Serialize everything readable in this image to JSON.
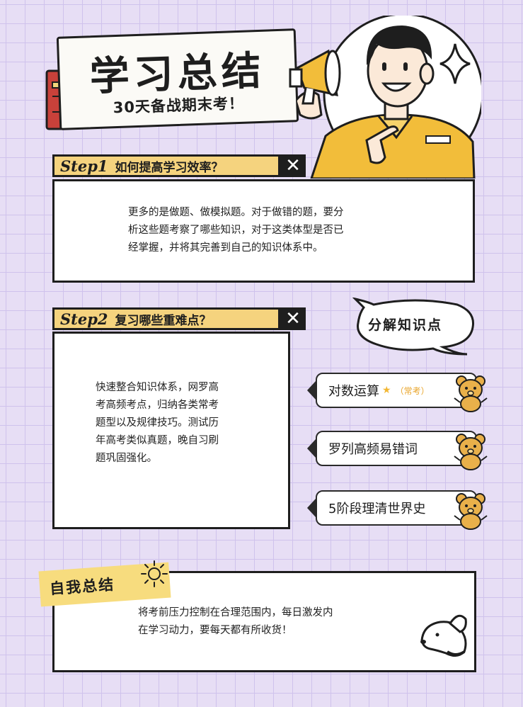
{
  "header": {
    "title": "学习总结",
    "subtitle": "30天备战期末考！"
  },
  "step1": {
    "tag": "Step1",
    "question": "如何提高学习效率？",
    "close": "✕",
    "lines": [
      "更多的是做题、做模拟题。对于做错的题，要分",
      "析这些题考察了哪些知识，对于这类体型是否已",
      "经掌握，并将其完善到自己的知识体系中。"
    ]
  },
  "step2": {
    "tag": "Step2",
    "question": "复习哪些重难点？",
    "close": "✕",
    "lines": [
      "快速整合知识体系，网罗高",
      "考高频考点，归纳各类常考",
      "题型以及规律技巧。测试历",
      "年高考类似真题，晚自习刷",
      "题巩固强化。"
    ]
  },
  "knowledge": {
    "bubble_label": "分解知识点",
    "items": [
      {
        "label": "对数运算",
        "star": "★",
        "hint": "（常考）"
      },
      {
        "label": "罗列高频易错词",
        "star": "",
        "hint": ""
      },
      {
        "label": "5阶段理清世界史",
        "star": "",
        "hint": ""
      }
    ]
  },
  "summary": {
    "label": "自我总结",
    "lines": [
      "将考前压力控制在合理范围内，每日激发内",
      "在学习动力，要每天都有所收货！"
    ]
  },
  "colors": {
    "background": "#e7def5",
    "accent_yellow": "#f5d37e",
    "ink": "#1e1e1e",
    "shirt_yellow": "#f2bd3a"
  }
}
